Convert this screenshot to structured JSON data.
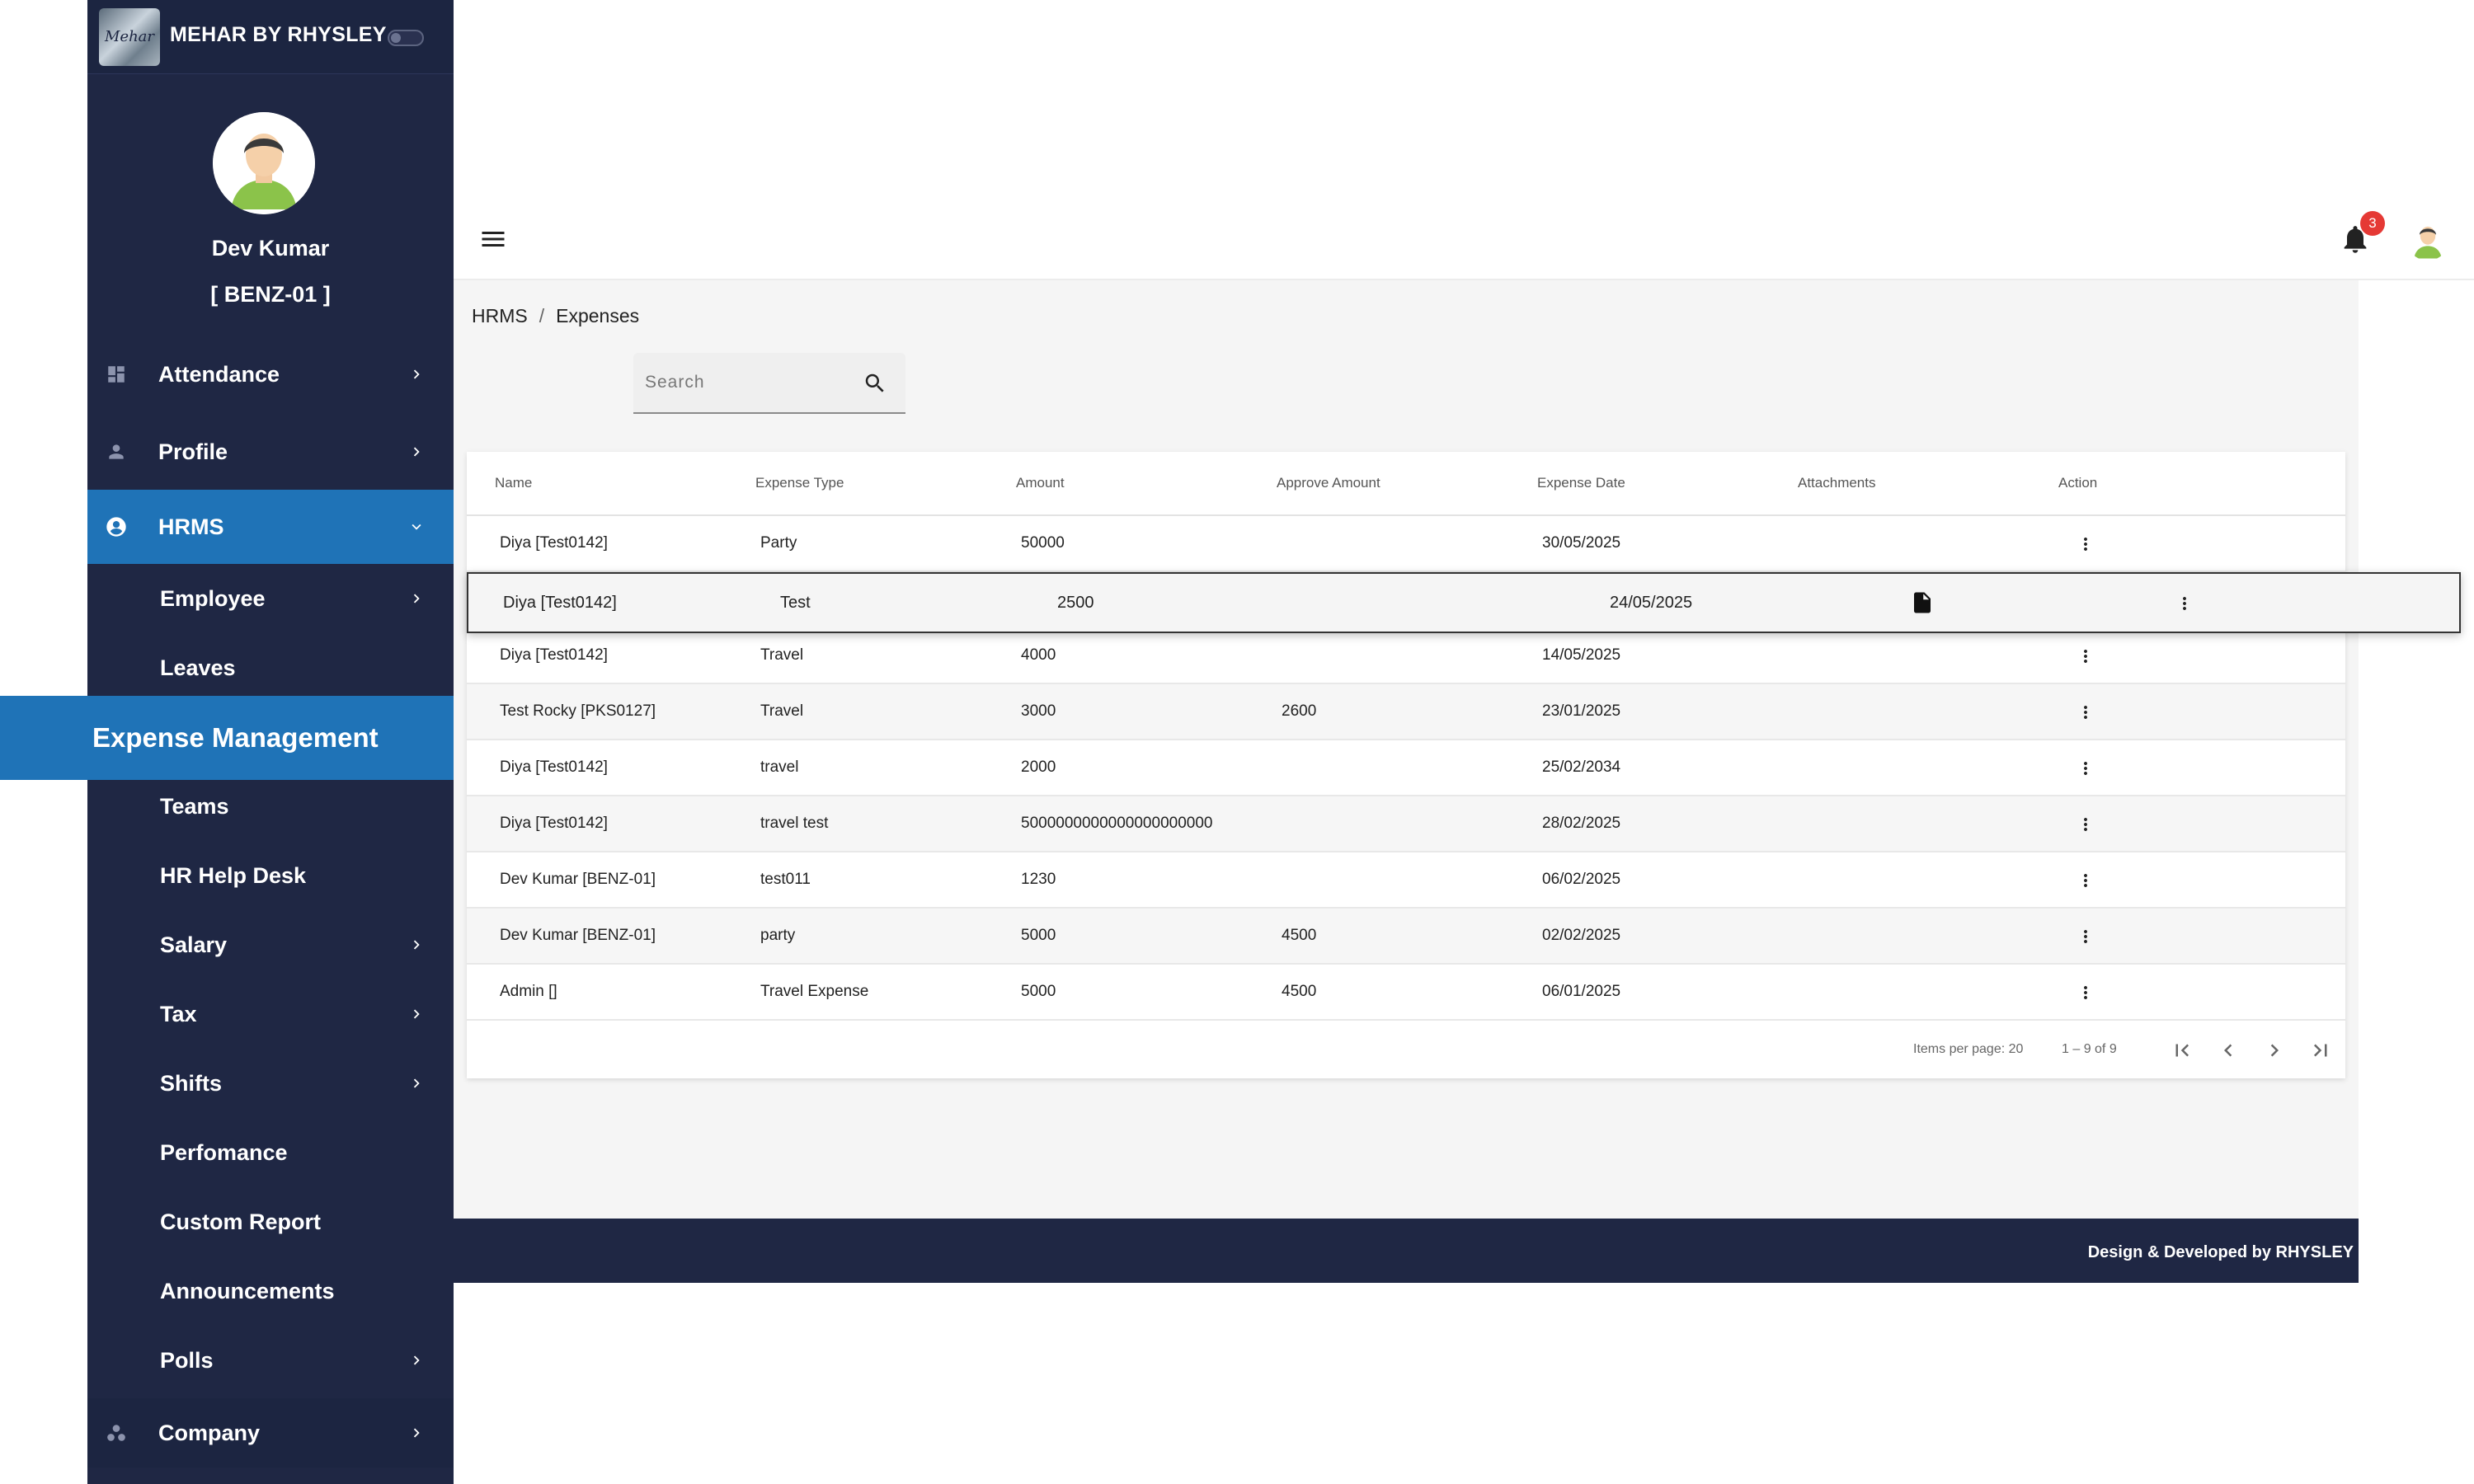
{
  "brand": {
    "name": "MEHAR BY RHYSLEY",
    "logo_text": "Mehar"
  },
  "user": {
    "name": "Dev Kumar",
    "code": "[ BENZ-01 ]"
  },
  "sidebar": {
    "attendance": "Attendance",
    "profile": "Profile",
    "hrms": "HRMS",
    "employee": "Employee",
    "leaves": "Leaves",
    "expense": "Expense Management",
    "teams": "Teams",
    "helpdesk": "HR Help Desk",
    "salary": "Salary",
    "tax": "Tax",
    "shifts": "Shifts",
    "performance": "Perfomance",
    "custom_report": "Custom Report",
    "announcements": "Announcements",
    "polls": "Polls",
    "company": "Company"
  },
  "header": {
    "notification_count": "3"
  },
  "breadcrumb": {
    "home": "HRMS",
    "separator": "/",
    "current": "Expenses"
  },
  "search": {
    "placeholder": "Search"
  },
  "table": {
    "columns": {
      "name": "Name",
      "type": "Expense Type",
      "amount": "Amount",
      "approve": "Approve Amount",
      "date": "Expense Date",
      "attachments": "Attachments",
      "action": "Action"
    },
    "rows": [
      {
        "name": "Diya [Test0142]",
        "type": "Party",
        "amount": "50000",
        "approve": "",
        "date": "30/05/2025"
      },
      {
        "name": "Diya [Test0142]",
        "type": "Test",
        "amount": "2500",
        "approve": "",
        "date": "24/05/2025"
      },
      {
        "name": "Diya [Test0142]",
        "type": "Travel",
        "amount": "4000",
        "approve": "",
        "date": "14/05/2025"
      },
      {
        "name": "Test Rocky [PKS0127]",
        "type": "Travel",
        "amount": "3000",
        "approve": "2600",
        "date": "23/01/2025"
      },
      {
        "name": "Diya [Test0142]",
        "type": "travel",
        "amount": "2000",
        "approve": "",
        "date": "25/02/2034"
      },
      {
        "name": "Diya [Test0142]",
        "type": "travel test",
        "amount": "5000000000000000000000",
        "approve": "",
        "date": "28/02/2025"
      },
      {
        "name": "Dev Kumar [BENZ-01]",
        "type": "test011",
        "amount": "1230",
        "approve": "",
        "date": "06/02/2025"
      },
      {
        "name": "Dev Kumar [BENZ-01]",
        "type": "party",
        "amount": "5000",
        "approve": "4500",
        "date": "02/02/2025"
      },
      {
        "name": "Admin []",
        "type": "Travel Expense",
        "amount": "5000",
        "approve": "4500",
        "date": "06/01/2025"
      }
    ]
  },
  "paginator": {
    "items_per_page": "Items per page: 20",
    "range": "1 – 9 of 9"
  },
  "footer": {
    "text": "Design & Developed by  RHYSLEY"
  },
  "colors": {
    "sidebar_bg": "#1f2744",
    "active_bg": "#1f73b7",
    "badge": "#e53935"
  },
  "icons": {
    "attendance": "dashboard-icon",
    "profile": "person-icon",
    "hrms": "account-circle-icon",
    "company": "workspaces-icon",
    "attachment": "file-icon",
    "action": "more-vert-icon"
  }
}
